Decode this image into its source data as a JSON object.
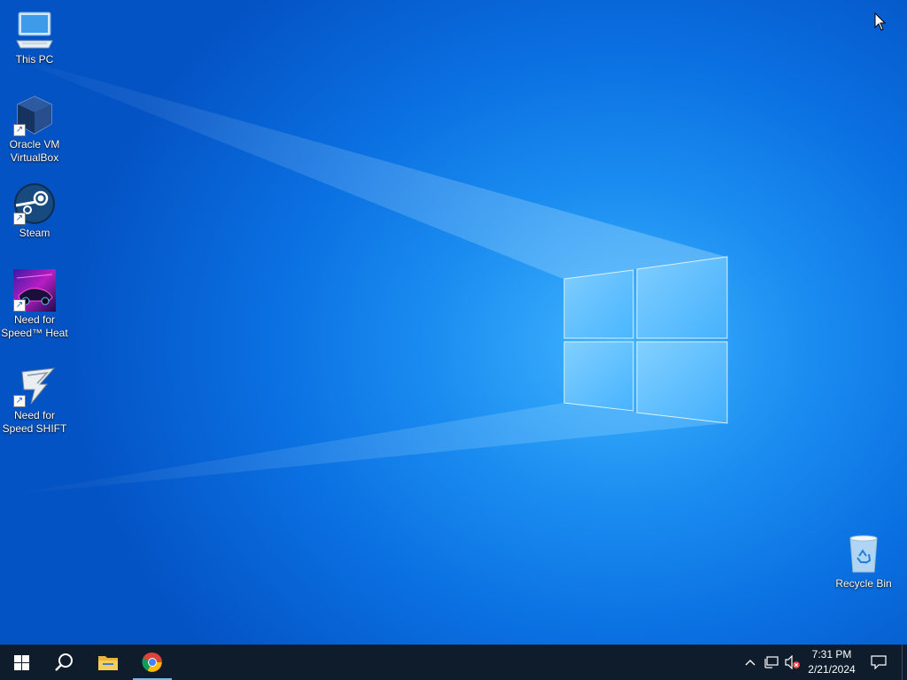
{
  "desktop": {
    "icons": [
      {
        "label_line1": "This PC",
        "label_line2": ""
      },
      {
        "label_line1": "Oracle VM",
        "label_line2": "VirtualBox"
      },
      {
        "label_line1": "Steam",
        "label_line2": ""
      },
      {
        "label_line1": "Need for",
        "label_line2": "Speed™ Heat"
      },
      {
        "label_line1": "Need for",
        "label_line2": "Speed SHIFT"
      }
    ],
    "recycle_bin": {
      "label": "Recycle Bin"
    }
  },
  "taskbar": {
    "start_icon": "windows-logo-icon",
    "search_icon": "search-icon",
    "pinned": [
      {
        "name": "File Explorer",
        "icon": "file-explorer-icon",
        "active": false
      },
      {
        "name": "Google Chrome",
        "icon": "chrome-icon",
        "active": true
      }
    ],
    "tray": {
      "icons": [
        "chevron-up-icon",
        "network-icon",
        "volume-muted-icon"
      ],
      "time": "7:31 PM",
      "date": "2/21/2024",
      "notification_icon": "notification-icon"
    }
  },
  "colors": {
    "taskbar_bg": "#0e1c2b",
    "desktop_blue": "#0a6fe0",
    "accent": "#76b9ed"
  }
}
